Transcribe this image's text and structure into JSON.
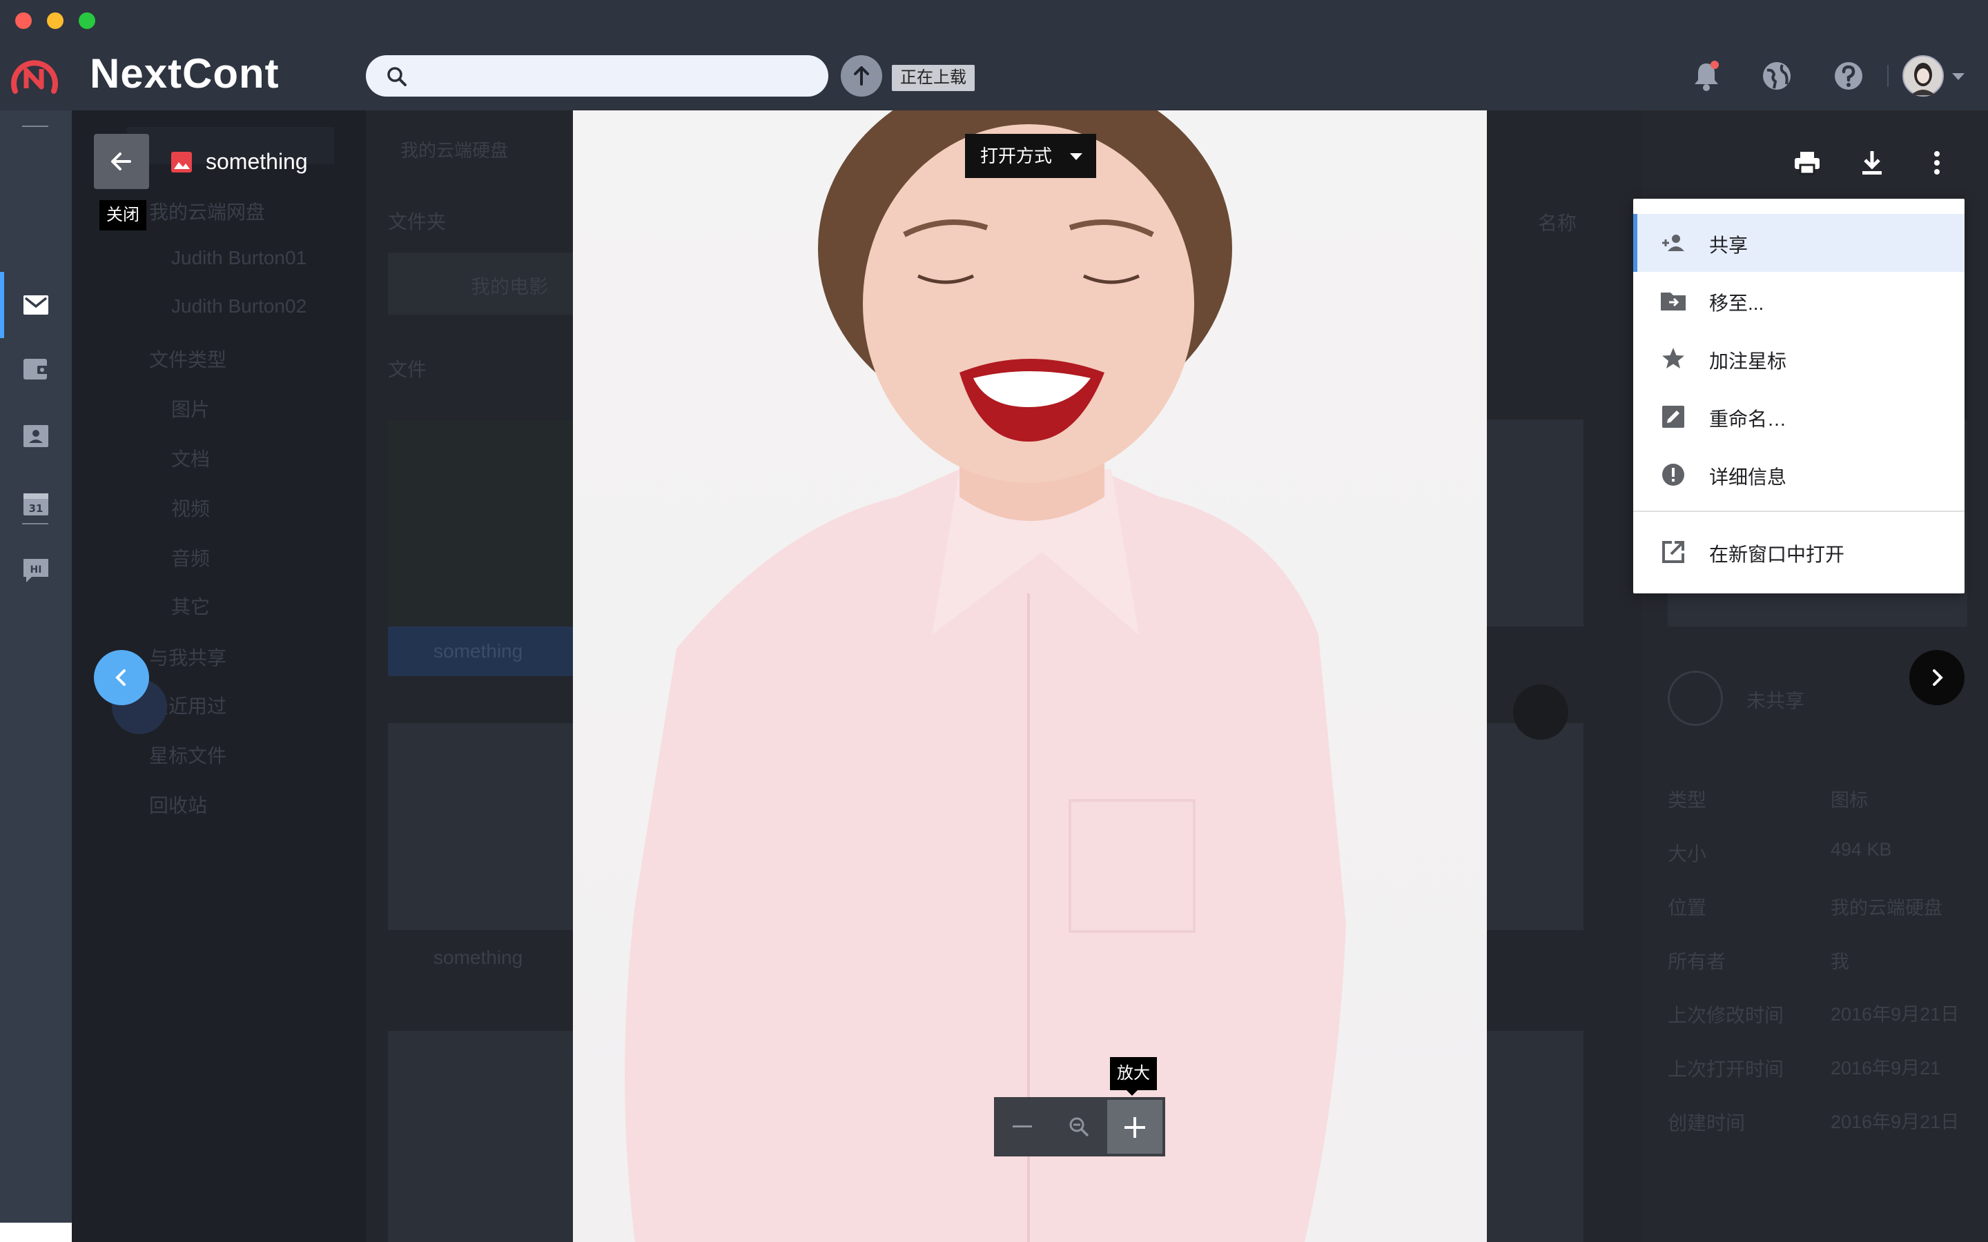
{
  "app": {
    "name": "NextCont",
    "upload_status": "正在上载"
  },
  "colors": {
    "accent": "#4a90e2",
    "brand": "#e8434b",
    "topbar": "#2e3440"
  },
  "icons": {
    "notifications": "bell-icon",
    "web": "globe-icon",
    "help": "help-icon",
    "avatar": "avatar"
  },
  "viewer": {
    "file_name": "something",
    "close_tooltip": "关闭",
    "open_with": "打开方式",
    "zoom_in_tooltip": "放大"
  },
  "menu": {
    "items": [
      {
        "label": "共享",
        "icon": "person-add-icon"
      },
      {
        "label": "移至...",
        "icon": "folder-move-icon"
      },
      {
        "label": "加注星标",
        "icon": "star-icon"
      },
      {
        "label": "重命名…",
        "icon": "edit-icon"
      },
      {
        "label": "详细信息",
        "icon": "info-icon"
      },
      {
        "label": "在新窗口中打开",
        "icon": "open-in-new-icon"
      }
    ]
  },
  "background": {
    "tree": {
      "root": "我的云端网盘",
      "folders": [
        "Judith Burton01",
        "Judith Burton02"
      ],
      "file_types": "文件类型",
      "types": [
        "图片",
        "文档",
        "视频",
        "音频",
        "其它"
      ],
      "shared": "与我共享",
      "recent": "最近用过",
      "starred": "星标文件",
      "trash": "回收站"
    },
    "breadcrumb": "我的云端硬盘",
    "folders_heading": "文件夹",
    "folder_item": "我的电影",
    "files_heading": "文件",
    "sort_label": "名称",
    "file_labels": [
      "something",
      "something"
    ],
    "details": {
      "share_status": "未共享",
      "rows": [
        {
          "k": "类型",
          "v": "图标"
        },
        {
          "k": "大小",
          "v": "494 KB"
        },
        {
          "k": "位置",
          "v": "我的云端硬盘"
        },
        {
          "k": "所有者",
          "v": "我"
        },
        {
          "k": "上次修改时间",
          "v": "2016年9月21日"
        },
        {
          "k": "上次打开时间",
          "v": "2016年9月21"
        },
        {
          "k": "创建时间",
          "v": "2016年9月21日"
        }
      ]
    }
  }
}
